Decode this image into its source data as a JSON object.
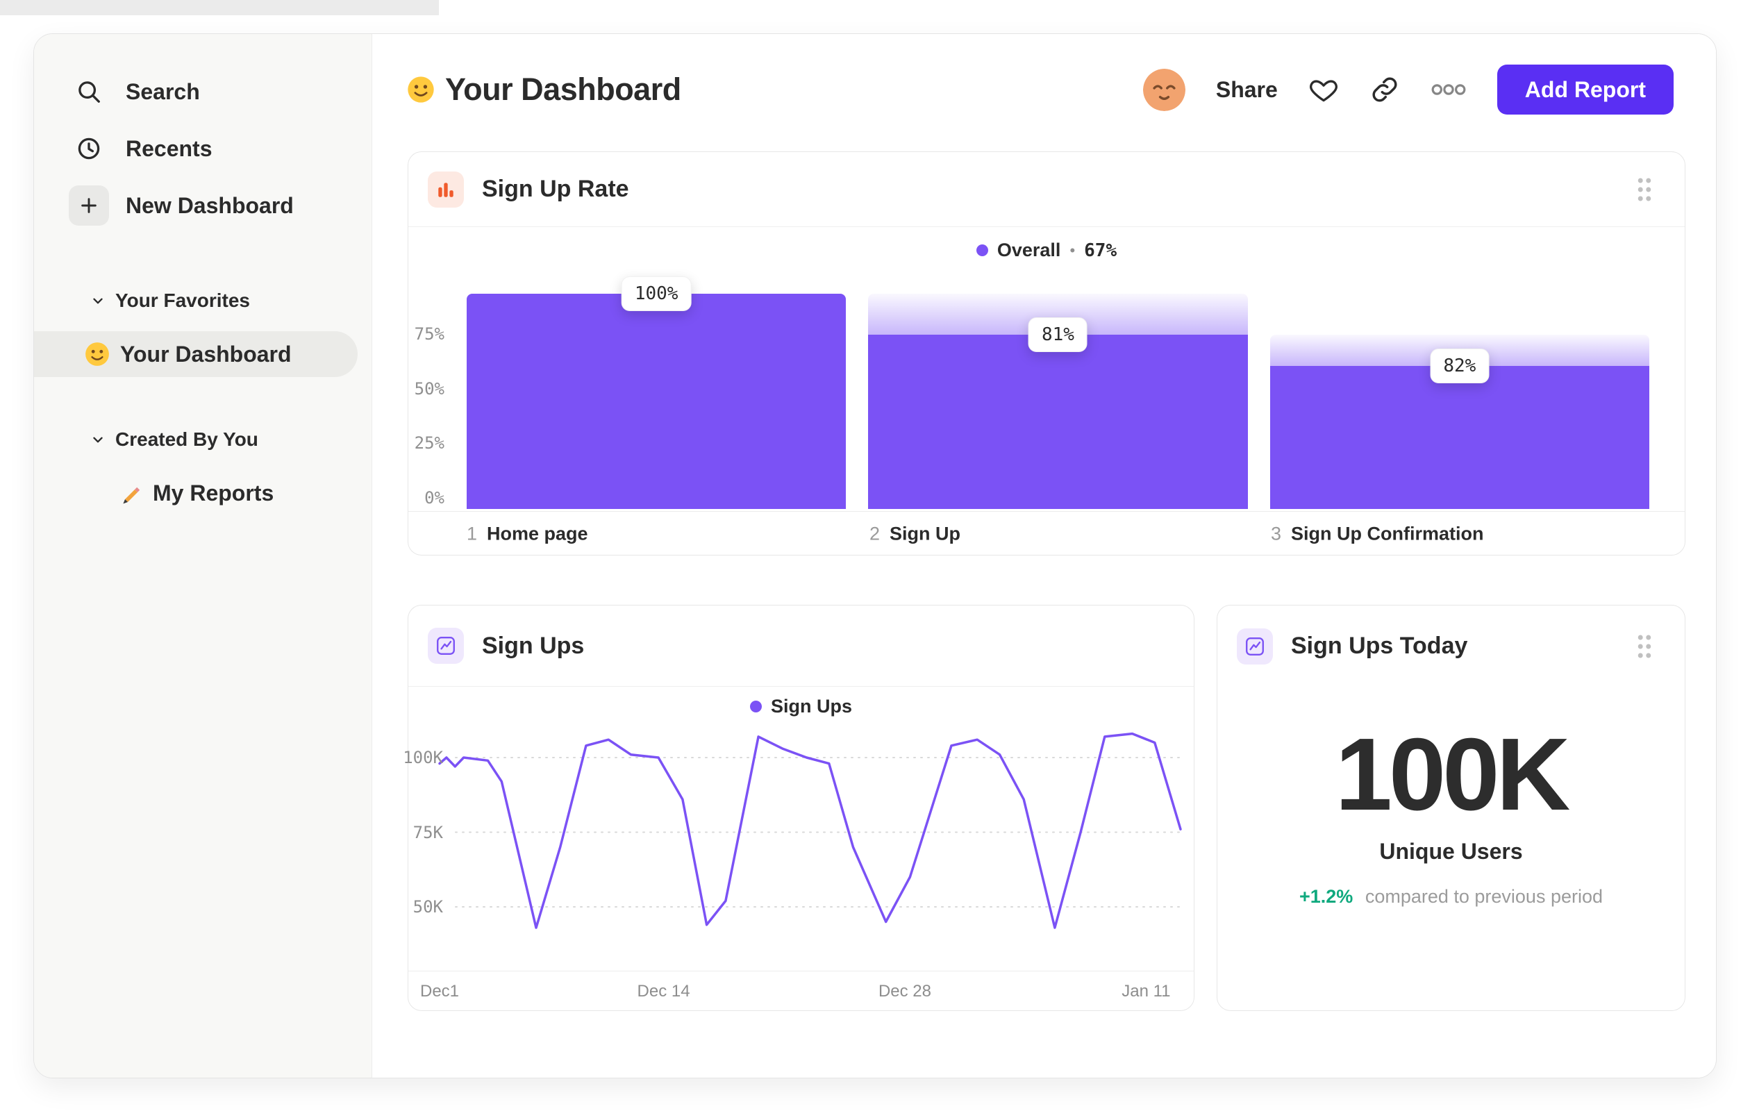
{
  "sidebar": {
    "search": "Search",
    "recents": "Recents",
    "new_dashboard": "New Dashboard",
    "favorites_title": "Your Favorites",
    "favorite_item": "Your Dashboard",
    "created_title": "Created By You",
    "created_item": "My Reports"
  },
  "header": {
    "title": "Your Dashboard",
    "share": "Share",
    "add_report": "Add Report"
  },
  "cards": {
    "funnel": {
      "title": "Sign Up Rate"
    },
    "line": {
      "title": "Sign Ups"
    },
    "kpi": {
      "title": "Sign Ups Today",
      "value": "100K",
      "label": "Unique Users",
      "delta": "+1.2%",
      "note": "compared to previous period"
    }
  },
  "icons": {
    "dashboard_emoji": "smiling-face",
    "avatar_emoji": "relieved-face",
    "reports_icon": "pencil"
  },
  "colors": {
    "accent_purple": "#7B52F5",
    "button_purple": "#5A2FF3",
    "orange": "#F05A2B",
    "green": "#0FA97E"
  },
  "chart_data": [
    {
      "type": "bar",
      "title": "Sign Up Rate",
      "legend": {
        "label": "Overall",
        "separator": "•",
        "value": "67%"
      },
      "y_ticks": [
        "75%",
        "50%",
        "25%",
        "0%"
      ],
      "ylim": [
        0,
        100
      ],
      "steps": [
        {
          "index": "1",
          "label": "Home page",
          "conversion_label": "100%",
          "absolute_pct": 100,
          "previous_pct": 100
        },
        {
          "index": "2",
          "label": "Sign Up",
          "conversion_label": "81%",
          "absolute_pct": 81,
          "previous_pct": 100
        },
        {
          "index": "3",
          "label": "Sign Up Confirmation",
          "conversion_label": "82%",
          "absolute_pct": 66.4,
          "previous_pct": 81
        }
      ]
    },
    {
      "type": "line",
      "title": "Sign Ups",
      "legend": {
        "label": "Sign Ups"
      },
      "unit": "K",
      "y_ticks": [
        {
          "label": "100K",
          "value": 100
        },
        {
          "label": "75K",
          "value": 75
        },
        {
          "label": "50K",
          "value": 50
        }
      ],
      "x_ticks": [
        {
          "label": "Dec1",
          "day": 0
        },
        {
          "label": "Dec 14",
          "day": 13
        },
        {
          "label": "Dec 28",
          "day": 27
        },
        {
          "label": "Jan 11",
          "day": 41
        }
      ],
      "x_range_days": [
        0,
        43
      ],
      "points": [
        [
          0,
          98
        ],
        [
          0.4,
          100
        ],
        [
          0.9,
          97
        ],
        [
          1.4,
          100
        ],
        [
          2.8,
          99
        ],
        [
          3.6,
          92
        ],
        [
          5.6,
          43
        ],
        [
          7,
          70
        ],
        [
          8.5,
          104
        ],
        [
          9.8,
          106
        ],
        [
          11.1,
          101
        ],
        [
          12.7,
          100
        ],
        [
          14.1,
          86
        ],
        [
          15.5,
          44
        ],
        [
          16.6,
          52
        ],
        [
          18.5,
          107
        ],
        [
          19.9,
          103
        ],
        [
          21.3,
          100
        ],
        [
          22.6,
          98
        ],
        [
          24,
          70
        ],
        [
          25.9,
          45
        ],
        [
          27.3,
          60
        ],
        [
          29.7,
          104
        ],
        [
          31.2,
          106
        ],
        [
          32.5,
          101
        ],
        [
          33.9,
          86
        ],
        [
          35.7,
          43
        ],
        [
          37.2,
          75
        ],
        [
          38.6,
          107
        ],
        [
          40.2,
          108
        ],
        [
          41.5,
          105
        ],
        [
          43,
          76
        ]
      ]
    }
  ]
}
